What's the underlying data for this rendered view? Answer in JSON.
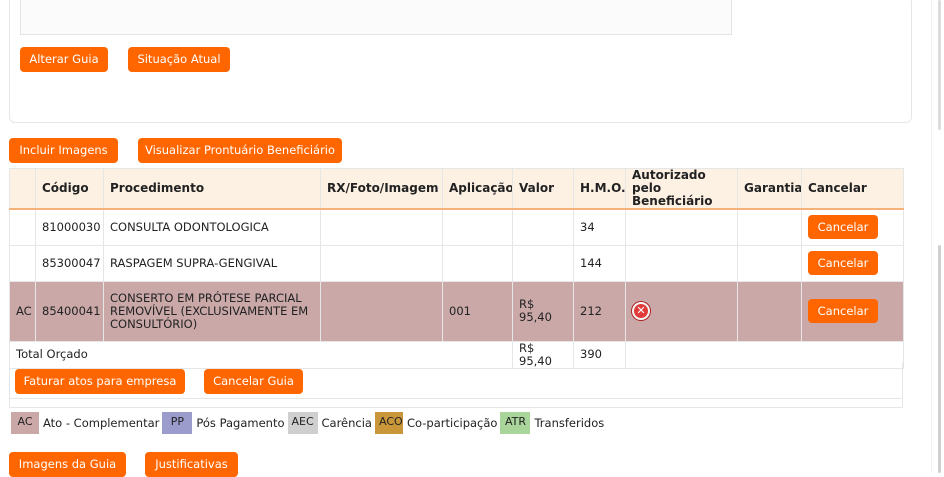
{
  "top_panel": {
    "alterar_guia": "Alterar Guia",
    "situacao_atual": "Situação Atual"
  },
  "toolbar": {
    "incluir_imagens": "Incluir Imagens",
    "visualizar_prontuario": "Visualizar Prontuário Beneficiário"
  },
  "table": {
    "headers": [
      "",
      "Código",
      "Procedimento",
      "RX/Foto/Imagem",
      "Aplicação",
      "Valor",
      "H.M.O.",
      "Autorizado pelo Beneficiário",
      "Garantia",
      "Cancelar"
    ],
    "rows": [
      {
        "tag": "",
        "codigo": "81000030",
        "procedimento": "CONSULTA ODONTOLOGICA",
        "rx": "",
        "aplicacao": "",
        "valor": "",
        "hmo": "34",
        "garantia": "",
        "cancel_label": "Cancelar"
      },
      {
        "tag": "",
        "codigo": "85300047",
        "procedimento": "RASPAGEM SUPRA-GENGIVAL",
        "rx": "",
        "aplicacao": "",
        "valor": "",
        "hmo": "144",
        "garantia": "",
        "cancel_label": "Cancelar"
      },
      {
        "tag": "AC",
        "codigo": "85400041",
        "procedimento": "CONSERTO EM PRÓTESE PARCIAL REMOVÍVEL (EXCLUSIVAMENTE EM CONSULTÓRIO)",
        "rx": "",
        "aplicacao": "001",
        "valor": "R$ 95,40",
        "hmo": "212",
        "autorizado_icon": "x-circle-icon",
        "garantia": "",
        "cancel_label": "Cancelar"
      }
    ],
    "total_label": "Total Orçado",
    "total_valor": "R$ 95,40",
    "total_hmo": "390"
  },
  "actions": {
    "faturar": "Faturar atos para empresa",
    "cancelar_guia": "Cancelar Guia"
  },
  "legend": [
    {
      "code": "AC",
      "label": "Ato - Complementar",
      "color": "#caa8a8"
    },
    {
      "code": "PP",
      "label": "Pós Pagamento",
      "color": "#9b9bcc"
    },
    {
      "code": "AEC",
      "label": "Carência",
      "color": "#cfcfcf"
    },
    {
      "code": "ACO",
      "label": "Co-participação",
      "color": "#c9963a"
    },
    {
      "code": "ATR",
      "label": "Transferidos",
      "color": "#a9d49a"
    }
  ],
  "bottom": {
    "imagens_da_guia": "Imagens da Guia",
    "justificativas": "Justificativas"
  },
  "colors": {
    "accent": "#ff6600",
    "header_bg": "#fdf1e4",
    "row_ac": "#caa8a8"
  }
}
